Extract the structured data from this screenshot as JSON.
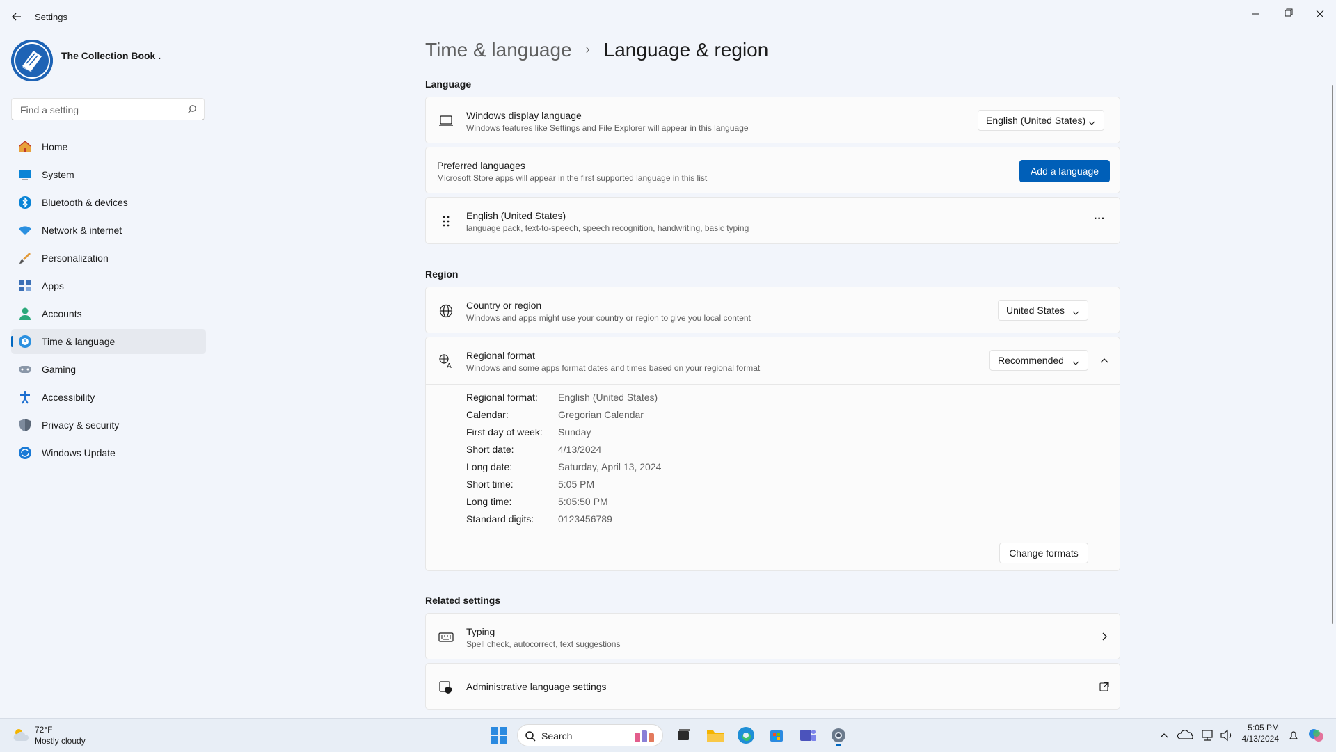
{
  "window": {
    "app_title": "Settings"
  },
  "profile": {
    "name": "The Collection Book ."
  },
  "search": {
    "placeholder": "Find a setting"
  },
  "nav": {
    "items": [
      {
        "label": "Home",
        "icon": "home-icon"
      },
      {
        "label": "System",
        "icon": "monitor-icon"
      },
      {
        "label": "Bluetooth & devices",
        "icon": "bluetooth-icon"
      },
      {
        "label": "Network & internet",
        "icon": "wifi-icon"
      },
      {
        "label": "Personalization",
        "icon": "brush-icon"
      },
      {
        "label": "Apps",
        "icon": "apps-icon"
      },
      {
        "label": "Accounts",
        "icon": "person-icon"
      },
      {
        "label": "Time & language",
        "icon": "clock-globe-icon",
        "active": true
      },
      {
        "label": "Gaming",
        "icon": "gamepad-icon"
      },
      {
        "label": "Accessibility",
        "icon": "accessibility-icon"
      },
      {
        "label": "Privacy & security",
        "icon": "shield-icon"
      },
      {
        "label": "Windows Update",
        "icon": "update-icon"
      }
    ]
  },
  "breadcrumb": {
    "parent": "Time & language",
    "separator": "›",
    "current": "Language & region"
  },
  "language": {
    "section_title": "Language",
    "display_language": {
      "title": "Windows display language",
      "subtitle": "Windows features like Settings and File Explorer will appear in this language",
      "value": "English (United States)"
    },
    "preferred": {
      "title": "Preferred languages",
      "subtitle": "Microsoft Store apps will appear in the first supported language in this list",
      "add_button": "Add a language"
    },
    "installed": {
      "title": "English (United States)",
      "subtitle": "language pack, text-to-speech, speech recognition, handwriting, basic typing",
      "more_label": "···"
    }
  },
  "region": {
    "section_title": "Region",
    "country": {
      "title": "Country or region",
      "subtitle": "Windows and apps might use your country or region to give you local content",
      "value": "United States"
    },
    "regional_format": {
      "title": "Regional format",
      "subtitle": "Windows and some apps format dates and times based on your regional format",
      "value": "Recommended",
      "details": [
        {
          "key": "Regional format:",
          "value": "English (United States)"
        },
        {
          "key": "Calendar:",
          "value": "Gregorian Calendar"
        },
        {
          "key": "First day of week:",
          "value": "Sunday"
        },
        {
          "key": "Short date:",
          "value": "4/13/2024"
        },
        {
          "key": "Long date:",
          "value": "Saturday, April 13, 2024"
        },
        {
          "key": "Short time:",
          "value": "5:05 PM"
        },
        {
          "key": "Long time:",
          "value": "5:05:50 PM"
        },
        {
          "key": "Standard digits:",
          "value": "0123456789"
        }
      ],
      "change_button": "Change formats"
    }
  },
  "related": {
    "section_title": "Related settings",
    "typing": {
      "title": "Typing",
      "subtitle": "Spell check, autocorrect, text suggestions"
    },
    "admin": {
      "title": "Administrative language settings"
    }
  },
  "taskbar": {
    "weather": {
      "temp": "72°F",
      "desc": "Mostly cloudy"
    },
    "search_label": "Search",
    "time": "5:05 PM",
    "date": "4/13/2024"
  },
  "colors": {
    "accent": "#005fb8",
    "background": "#f2f5fb",
    "card": "#fbfbfb"
  }
}
